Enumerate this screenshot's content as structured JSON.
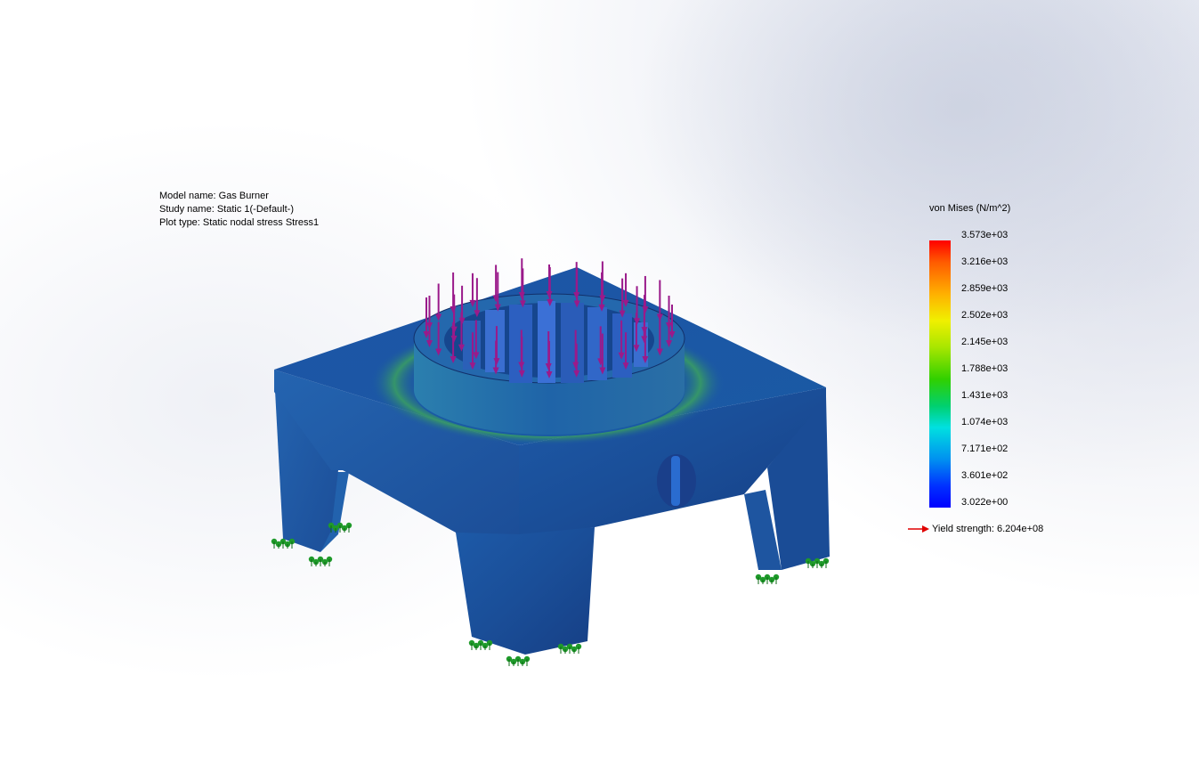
{
  "plot_info": {
    "model_name": "Model name: Gas Burner",
    "study_name": "Study name: Static 1(-Default-)",
    "plot_type": "Plot type: Static nodal stress Stress1"
  },
  "legend": {
    "title": "von Mises (N/m^2)",
    "ticks": [
      "3.573e+03",
      "3.216e+03",
      "2.859e+03",
      "2.502e+03",
      "2.145e+03",
      "1.788e+03",
      "1.431e+03",
      "1.074e+03",
      "7.171e+02",
      "3.601e+02",
      "3.022e+00"
    ],
    "yield_strength": "Yield strength: 6.204e+08",
    "colors": {
      "max": "#ff0000",
      "min": "#0000ff",
      "yield_arrow": "#e00000"
    }
  },
  "model": {
    "colors": {
      "body": "#1a4fa8",
      "stress_band": "#2fa060",
      "load_arrow": "#9a1a8a",
      "fixture": "#1f9a2a"
    }
  }
}
